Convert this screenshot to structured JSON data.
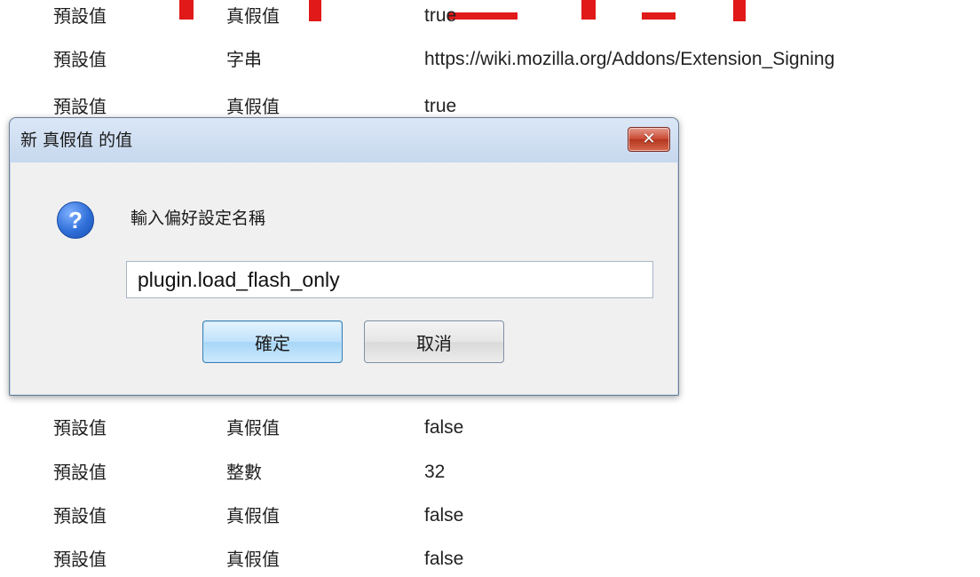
{
  "pref_list": {
    "rows": [
      {
        "status": "預設值",
        "type": "真假值",
        "value": "true"
      },
      {
        "status": "預設值",
        "type": "字串",
        "value": "https://wiki.mozilla.org/Addons/Extension_Signing"
      },
      {
        "status": "預設值",
        "type": "真假值",
        "value": "true"
      },
      {
        "status": "預設值",
        "type": "真假值",
        "value": "false"
      },
      {
        "status": "預設值",
        "type": "整數",
        "value": "32"
      },
      {
        "status": "預設值",
        "type": "真假值",
        "value": "false"
      },
      {
        "status": "預設值",
        "type": "真假值",
        "value": "false"
      }
    ]
  },
  "dialog": {
    "title": "新 真假值 的值",
    "close_label": "✕",
    "question_icon": "?",
    "prompt": "輸入偏好設定名稱",
    "input_value": "plugin.load_flash_only",
    "ok_label": "確定",
    "cancel_label": "取消"
  },
  "colors": {
    "overlay_red": "#e11919",
    "dialog_title_bg": "#c6d8ee",
    "close_red": "#c8462f",
    "ok_button_blue": "#bfe2fb"
  }
}
